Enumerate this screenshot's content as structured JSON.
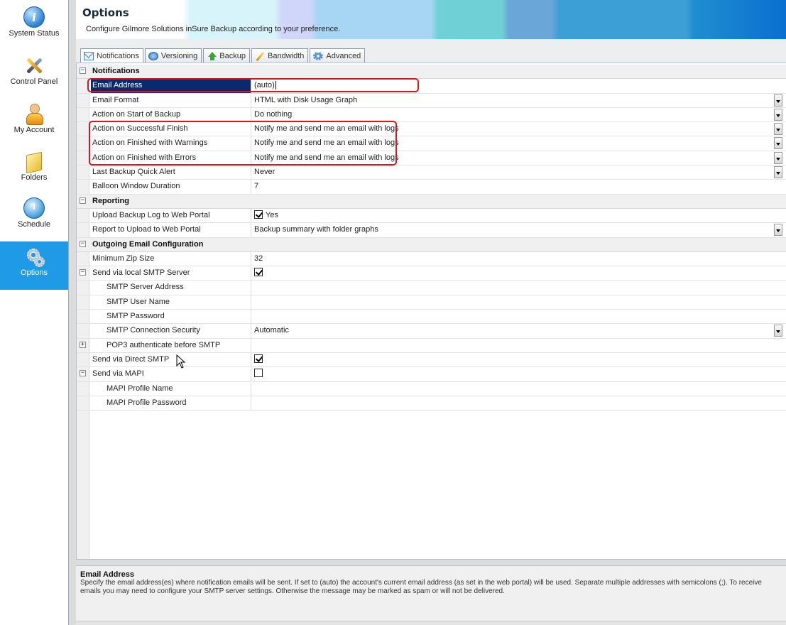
{
  "sidebar": {
    "items": [
      {
        "label": "System Status",
        "icon": "info-icon"
      },
      {
        "label": "Control Panel",
        "icon": "tools-icon"
      },
      {
        "label": "My Account",
        "icon": "user-icon"
      },
      {
        "label": "Folders",
        "icon": "folder-icon"
      },
      {
        "label": "Schedule",
        "icon": "clock-icon"
      },
      {
        "label": "Options",
        "icon": "gears-icon",
        "active": true
      }
    ]
  },
  "header": {
    "title": "Options",
    "subtitle": "Configure Gilmore Solutions inSure Backup according to your preference."
  },
  "tabs": [
    {
      "label": "Notifications",
      "icon": "mail-icon",
      "active": true
    },
    {
      "label": "Versioning",
      "icon": "versioning-icon"
    },
    {
      "label": "Backup",
      "icon": "upload-arrow-icon"
    },
    {
      "label": "Bandwidth",
      "icon": "bandwidth-icon"
    },
    {
      "label": "Advanced",
      "icon": "advanced-gear-icon"
    }
  ],
  "grid": {
    "notifications": {
      "title": "Notifications",
      "email_address": {
        "label": "Email Address",
        "value": "(auto)"
      },
      "email_format": {
        "label": "Email Format",
        "value": "HTML with Disk Usage Graph"
      },
      "start_backup": {
        "label": "Action on Start of Backup",
        "value": "Do nothing"
      },
      "successful_finish": {
        "label": "Action on Successful Finish",
        "value": "Notify me and send me an email with logs"
      },
      "finished_warnings": {
        "label": "Action on Finished with Warnings",
        "value": "Notify me and send me an email with logs"
      },
      "finished_errors": {
        "label": "Action on Finished with Errors",
        "value": "Notify me and send me an email with logs"
      },
      "quick_alert": {
        "label": "Last Backup Quick Alert",
        "value": "Never"
      },
      "balloon_duration": {
        "label": "Balloon Window Duration",
        "value": "7"
      }
    },
    "reporting": {
      "title": "Reporting",
      "upload_log": {
        "label": "Upload Backup Log to Web Portal",
        "value": "Yes",
        "checked": true
      },
      "report_upload": {
        "label": "Report to Upload to Web Portal",
        "value": "Backup summary with folder graphs"
      }
    },
    "outgoing": {
      "title": "Outgoing Email Configuration",
      "min_zip": {
        "label": "Minimum Zip Size",
        "value": "32"
      },
      "local_smtp": {
        "label": "Send via local SMTP Server",
        "checked": true
      },
      "smtp_address": {
        "label": "SMTP Server Address",
        "value": ""
      },
      "smtp_user": {
        "label": "SMTP User Name",
        "value": ""
      },
      "smtp_password": {
        "label": "SMTP Password",
        "value": ""
      },
      "smtp_security": {
        "label": "SMTP Connection Security",
        "value": "Automatic"
      },
      "pop3_auth": {
        "label": "POP3 authenticate before SMTP",
        "value": ""
      },
      "direct_smtp": {
        "label": "Send via Direct SMTP",
        "checked": true
      },
      "mapi": {
        "label": "Send via MAPI",
        "checked": false
      },
      "mapi_profile": {
        "label": "MAPI Profile Name",
        "value": ""
      },
      "mapi_password": {
        "label": "MAPI Profile Password",
        "value": ""
      }
    }
  },
  "description": {
    "title": "Email Address",
    "text": "Specify the email address(es) where notification emails will be sent. If set to (auto) the account's current email address (as set in the web portal) will be used. Separate multiple addresses with semicolons (;). To receive emails you may need to configure your SMTP server settings. Otherwise the message may be marked as spam or will not be delivered."
  },
  "colors": {
    "accent": "#1e9ae6",
    "selected_row": "#0b2a6e",
    "highlight": "#e0151c"
  }
}
